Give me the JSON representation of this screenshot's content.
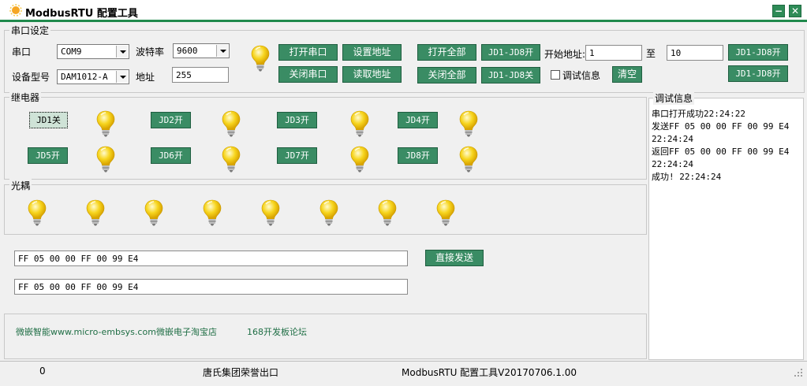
{
  "window": {
    "title": "ModbusRTU 配置工具",
    "min_label": "−",
    "close_label": "✕"
  },
  "serial": {
    "group_label": "串口设定",
    "port_label": "串口",
    "port_value": "COM9",
    "baud_label": "波特率",
    "baud_value": "9600",
    "model_label": "设备型号",
    "model_value": "DAM1012-A",
    "addr_label": "地址",
    "addr_value": "255",
    "open_port": "打开串口",
    "close_port": "关闭串口",
    "set_addr": "设置地址",
    "read_addr": "读取地址",
    "open_all": "打开全部",
    "close_all": "关闭全部",
    "jd_on": "JD1-JD8开",
    "jd_off": "JD1-JD8关",
    "start_addr_label": "开始地址:",
    "start_addr_value": "1",
    "to_label": "至",
    "end_addr_value": "10",
    "range_on_1": "JD1-JD8开",
    "range_on_2": "JD1-JD8开",
    "debug_check_label": "调试信息",
    "clear_button": "清空"
  },
  "relay": {
    "group_label": "继电器",
    "buttons": [
      "JD1关",
      "JD2开",
      "JD3开",
      "JD4开",
      "JD5开",
      "JD6开",
      "JD7开",
      "JD8开"
    ]
  },
  "optocoupler": {
    "group_label": "光耦"
  },
  "send": {
    "field1": "FF 05 00 00 FF 00 99 E4",
    "field2": "FF 05 00 00 FF 00 99 E4",
    "send_button": "直接发送"
  },
  "links": [
    "微嵌智能www.micro-embsys.com",
    "微嵌电子淘宝店",
    "168开发板论坛"
  ],
  "debug": {
    "group_label": "调试信息",
    "lines": [
      "串口打开成功22:24:22",
      "发送FF 05 00 00 FF 00 99 E4",
      "22:24:24",
      "返回FF 05 00 00 FF 00 99 E4",
      "22:24:24",
      "成功! 22:24:24"
    ]
  },
  "status": {
    "count": "0",
    "center": "唐氏集团荣誉出口",
    "version": "ModbusRTU 配置工具V20170706.1.00"
  },
  "colors": {
    "button_green": "#3a8c64",
    "title_accent": "#1f8a4c",
    "bulb": "#f7d51e"
  },
  "icons": {
    "app": "sun-icon",
    "bulb": "lightbulb-icon"
  }
}
